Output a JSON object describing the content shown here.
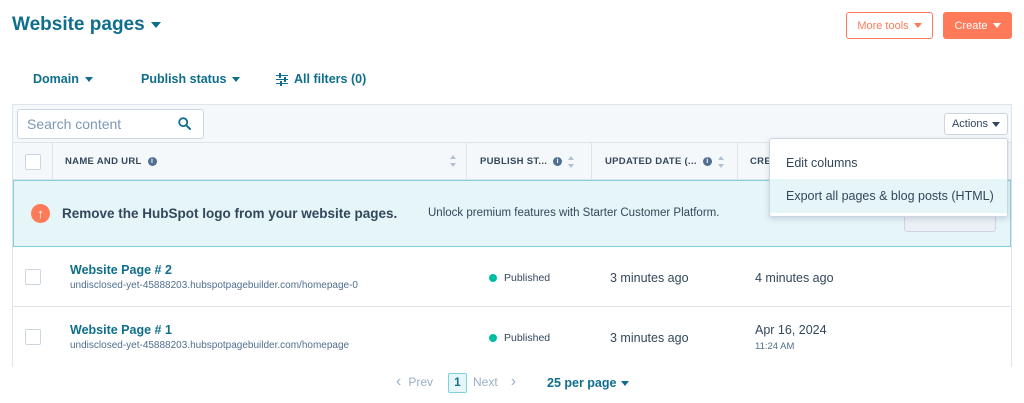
{
  "header": {
    "title": "Website pages",
    "more_tools_label": "More tools",
    "create_label": "Create"
  },
  "filters": {
    "domain_label": "Domain",
    "publish_status_label": "Publish status",
    "all_filters_label": "All filters (0)"
  },
  "toolbar": {
    "search_placeholder": "Search content",
    "actions_label": "Actions"
  },
  "columns": {
    "name": "NAME AND URL",
    "publish_status": "PUBLISH ST...",
    "updated_date": "UPDATED DATE (...",
    "created": "CRE"
  },
  "banner": {
    "title": "Remove the HubSpot logo from your website pages.",
    "text": "Unlock premium features with Starter Customer Platform."
  },
  "rows": [
    {
      "title": "Website Page # 2",
      "url": "undisclosed-yet-45888203.hubspotpagebuilder.com/homepage-0",
      "status": "Published",
      "updated": "3 minutes ago",
      "created": "4 minutes ago"
    },
    {
      "title": "Website Page # 1",
      "url": "undisclosed-yet-45888203.hubspotpagebuilder.com/homepage",
      "status": "Published",
      "updated": "3 minutes ago",
      "created": "Apr 16, 2024",
      "created_time": "11:24 AM"
    }
  ],
  "actions_menu": {
    "items": [
      "Edit columns",
      "Export all pages & blog posts (HTML)"
    ]
  },
  "pagination": {
    "prev_label": "Prev",
    "current_page": "1",
    "next_label": "Next",
    "per_page_label": "25 per page"
  },
  "colors": {
    "accent": "#ff7a59",
    "link": "#0f6e8c",
    "published": "#00bda5"
  }
}
